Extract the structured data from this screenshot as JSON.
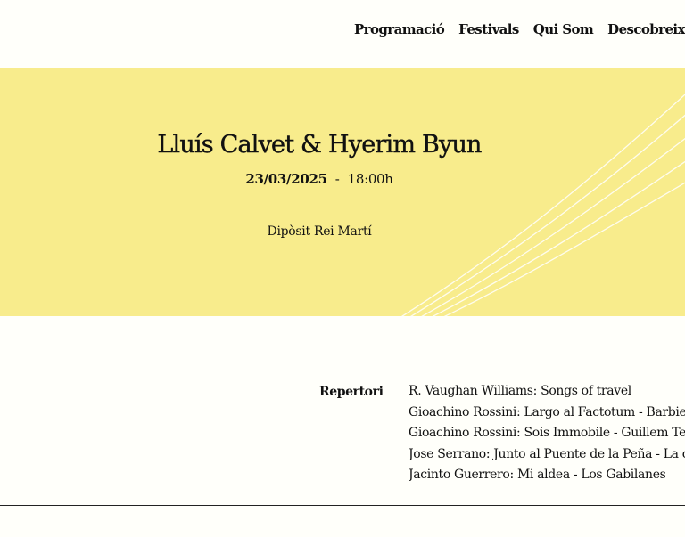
{
  "nav": {
    "items": [
      {
        "label": "Programació"
      },
      {
        "label": "Festivals"
      },
      {
        "label": "Qui Som"
      },
      {
        "label": "Descobreix Barcelona"
      }
    ]
  },
  "event": {
    "title": "Lluís Calvet & Hyerim Byun",
    "date": "23/03/2025",
    "separator": "-",
    "time": "18:00h",
    "venue": "Dipòsit Rei Martí"
  },
  "repertoire": {
    "label": "Repertori",
    "items": [
      "R. Vaughan Williams: Songs of travel",
      "Gioachino Rossini: Largo al Factotum - Barbiere di Siviglia",
      "Gioachino Rossini: Sois Immobile - Guillem Tell",
      "Jose Serrano: Junto al Puente de la Peña - La canción del olvido",
      "Jacinto Guerrero: Mi aldea - Los Gabilanes"
    ]
  },
  "colors": {
    "hero_background": "#f8ec8c",
    "page_background": "#fffffa",
    "text": "#111111"
  }
}
